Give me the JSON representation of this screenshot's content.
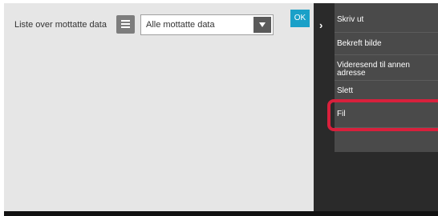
{
  "header": {
    "list_label": "Liste over mottatte data",
    "filter_select": {
      "selected": "Alle mottatte data"
    },
    "ok_label": "OK"
  },
  "side_menu": {
    "items": [
      {
        "label": "Skriv ut"
      },
      {
        "label": "Bekreft bilde"
      },
      {
        "label": "Videresend til annen adresse"
      },
      {
        "label": "Slett"
      },
      {
        "label": "Fil",
        "highlighted": true
      }
    ]
  },
  "colors": {
    "accent": "#1aa0c8",
    "highlight": "#d8203c",
    "menu_bg": "#4a4a4a",
    "panel_bg": "#e6e6e6"
  },
  "icons": {
    "list_view": "list-view-icon",
    "dropdown": "chevron-down-icon",
    "collapse": "chevron-right-icon"
  }
}
